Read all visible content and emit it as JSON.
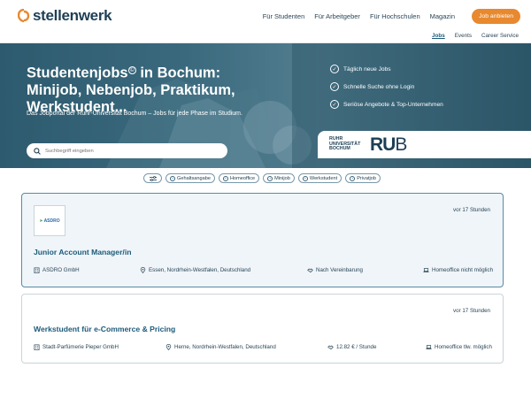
{
  "header": {
    "logo_text": "stellenwerk",
    "nav": [
      "Für Studenten",
      "Für Arbeitgeber",
      "Für Hochschulen",
      "Magazin"
    ],
    "cta_label": "Job anbieten",
    "subnav": [
      "Jobs",
      "Events",
      "Career Service"
    ],
    "accent_color": "#e8892f",
    "brand_color": "#1d3f55"
  },
  "hero": {
    "title_line1": "Studentenjobs",
    "title_mark": "©",
    "title_line1b": " in Bochum:",
    "title_line2": "Minijob, Nebenjob, Praktikum,",
    "title_line3": "Werkstudent...",
    "subtitle": "Das Jobportal der Ruhr-Universität Bochum – Jobs für jede Phase im Studium.",
    "search_placeholder": "Suchbegriff eingeben",
    "checks": [
      "Täglich neue Jobs",
      "Schnelle Suche ohne Login",
      "Seriöse Angebote & Top-Unternehmen"
    ],
    "uni_small": [
      "RUHR",
      "UNIVERSITÄT",
      "BOCHUM"
    ],
    "uni_big_bold": "RU",
    "uni_big_thin": "B"
  },
  "filters": {
    "toggle_icon": "sliders-icon",
    "chips": [
      "Gehaltsangabe",
      "Homeoffice",
      "Minijob",
      "Werkstudent",
      "Privatjob"
    ]
  },
  "jobs": [
    {
      "logo_text": "ASDRO",
      "time": "vor 17 Stunden",
      "title": "Junior Account Manager/in",
      "company": "ASDRO GmbH",
      "location": "Essen, Nordrhein-Westfalen, Deutschland",
      "salary": "Nach Vereinbarung",
      "homeoffice": "Homeoffice nicht möglich"
    },
    {
      "time": "vor 17 Stunden",
      "title": "Werkstudent für e-Commerce & Pricing",
      "company": "Stadt-Parfümerie Pieper GmbH",
      "location": "Herne, Nordrhein-Westfalen, Deutschland",
      "salary": "12.82 € / Stunde",
      "homeoffice": "Homeoffice tlw. möglich"
    }
  ]
}
